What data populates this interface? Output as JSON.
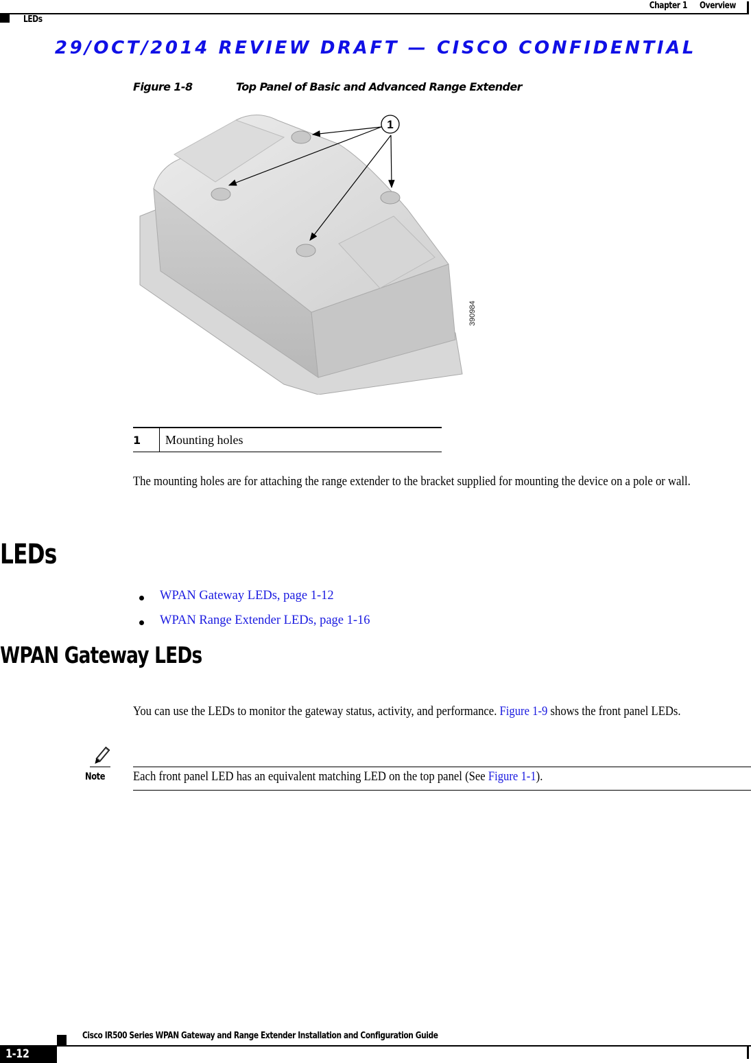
{
  "header": {
    "chapter": "Chapter 1",
    "chapter_title": "Overview",
    "section": "LEDs"
  },
  "draft_banner": {
    "text": "29/OCT/2014 REVIEW DRAFT — CISCO CONFIDENTIAL",
    "color": "#1010e6"
  },
  "figure": {
    "number": "Figure 1-8",
    "title": "Top Panel of Basic and Advanced Range Extender",
    "callout_marker": "1",
    "art_id": "390984",
    "icon": "range-extender-top-panel-illustration"
  },
  "callout_table": {
    "rows": [
      {
        "num": "1",
        "desc": "Mounting holes"
      }
    ]
  },
  "mounting_paragraph": "The mounting holes are for attaching the range extender to the bracket supplied for mounting the device on a pole or wall.",
  "sections": {
    "leds": {
      "heading": "LEDs",
      "links": [
        {
          "label": "WPAN Gateway LEDs, page 1-12"
        },
        {
          "label": "WPAN Range Extender LEDs, page 1-16"
        }
      ]
    },
    "gateway_leds": {
      "heading": "WPAN Gateway LEDs",
      "para_prefix": "You can use the LEDs to monitor the gateway status, activity, and performance.",
      "para_link": "Figure 1-9",
      "para_suffix": "shows the front panel LEDs."
    }
  },
  "note": {
    "icon": "pencil-note-icon",
    "label": "Note",
    "text_prefix": "Each front panel LED has an equivalent matching LED on the top panel (See",
    "text_link": "Figure 1-1",
    "text_suffix": ")."
  },
  "footer": {
    "guide_title": "Cisco IR500 Series WPAN Gateway and Range Extender Installation and Configuration Guide",
    "page_number": "1-12"
  },
  "colors": {
    "link": "#1a1ae0",
    "text": "#000000"
  }
}
